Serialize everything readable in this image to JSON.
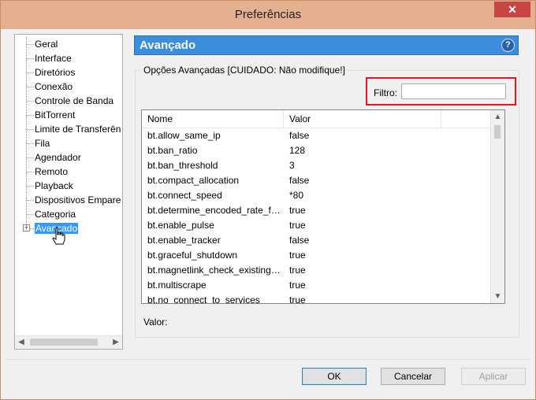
{
  "window": {
    "title": "Preferências",
    "close_glyph": "✕"
  },
  "sidebar": {
    "items": [
      {
        "label": "Geral"
      },
      {
        "label": "Interface"
      },
      {
        "label": "Diretórios"
      },
      {
        "label": "Conexão"
      },
      {
        "label": "Controle de Banda"
      },
      {
        "label": "BitTorrent"
      },
      {
        "label": "Limite de Transferência"
      },
      {
        "label": "Fila"
      },
      {
        "label": "Agendador"
      },
      {
        "label": "Remoto"
      },
      {
        "label": "Playback"
      },
      {
        "label": "Dispositivos Emparelhados"
      },
      {
        "label": "Categoria"
      },
      {
        "label": "Avançado",
        "selected": true,
        "expandable": true
      }
    ],
    "expander_glyph": "+",
    "scroll_left": "◀",
    "scroll_right": "▶"
  },
  "panel": {
    "title": "Avançado",
    "help_glyph": "?",
    "accent_color": "#3c8dde",
    "group_legend": "Opções Avançadas [CUIDADO: Não modifique!]",
    "filter_label": "Filtro:",
    "filter_value": "",
    "highlight_color": "#e0191f",
    "columns": [
      "Nome",
      "Valor"
    ],
    "rows": [
      {
        "name": "bt.allow_same_ip",
        "value": "false"
      },
      {
        "name": "bt.ban_ratio",
        "value": "128"
      },
      {
        "name": "bt.ban_threshold",
        "value": "3"
      },
      {
        "name": "bt.compact_allocation",
        "value": "false"
      },
      {
        "name": "bt.connect_speed",
        "value": "*80"
      },
      {
        "name": "bt.determine_encoded_rate_fo...",
        "value": "true"
      },
      {
        "name": "bt.enable_pulse",
        "value": "true"
      },
      {
        "name": "bt.enable_tracker",
        "value": "false"
      },
      {
        "name": "bt.graceful_shutdown",
        "value": "true"
      },
      {
        "name": "bt.magnetlink_check_existing_...",
        "value": "true"
      },
      {
        "name": "bt.multiscrape",
        "value": "true"
      },
      {
        "name": "bt.no_connect_to_services",
        "value": "true"
      }
    ],
    "scroll_up": "▲",
    "scroll_down": "▼",
    "value_label": "Valor:"
  },
  "footer": {
    "ok_label": "OK",
    "cancel_label": "Cancelar",
    "apply_label": "Aplicar"
  }
}
